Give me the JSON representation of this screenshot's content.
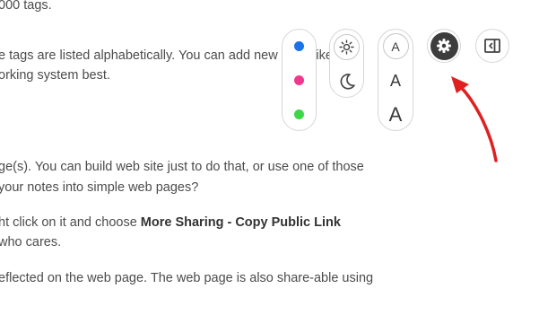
{
  "document": {
    "lines": [
      {
        "text": "000 tags."
      },
      {
        "text": "e tags are listed alphabetically. You can add new tags, like o"
      },
      {
        "text": "orking system best."
      },
      {
        "text": "ge(s). You can build web site just to do that, or use one of those"
      },
      {
        "text": " your notes into simple web pages?"
      },
      {
        "pre": "ht click on it and choose ",
        "bold": "More Sharing - Copy Public Link"
      },
      {
        "text": " who cares."
      },
      {
        "text": "eflected on the web page. The web page is also share-able using"
      }
    ]
  },
  "toolbar": {
    "color_options": [
      {
        "name": "blue",
        "color": "#1a73e8",
        "selected": true
      },
      {
        "name": "pink",
        "color": "#f0388c",
        "selected": false
      },
      {
        "name": "green",
        "color": "#3fd64a",
        "selected": false
      }
    ],
    "theme_options": [
      {
        "name": "light",
        "icon": "sun-icon",
        "selected": true
      },
      {
        "name": "dark",
        "icon": "moon-icon",
        "selected": false
      }
    ],
    "font_sizes": [
      {
        "name": "small",
        "label": "A",
        "selected": true
      },
      {
        "name": "medium",
        "label": "A",
        "selected": false
      },
      {
        "name": "large",
        "label": "A",
        "selected": false
      }
    ],
    "settings": {
      "icon": "gear-icon",
      "active": true
    },
    "panel_toggle": {
      "icon": "sidebar-panel-icon"
    }
  },
  "annotation": {
    "arrow_color": "#e02020"
  }
}
